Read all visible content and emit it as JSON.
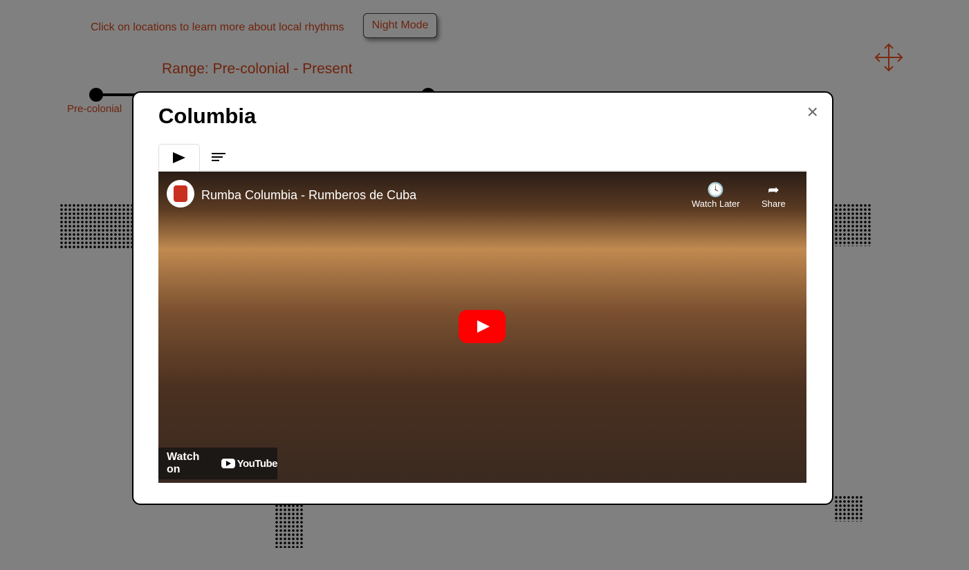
{
  "header": {
    "hint": "Click on locations to learn more about local rhythms",
    "night_mode_label": "Night Mode"
  },
  "range": {
    "label": "Range: Pre-colonial - Present",
    "start_label": "Pre-colonial"
  },
  "modal": {
    "title": "Columbia",
    "close": "×",
    "video": {
      "title": "Rumba Columbia - Rumberos de Cuba",
      "watch_later": "Watch Later",
      "share": "Share",
      "watch_on": "Watch on",
      "youtube": "YouTube"
    }
  }
}
